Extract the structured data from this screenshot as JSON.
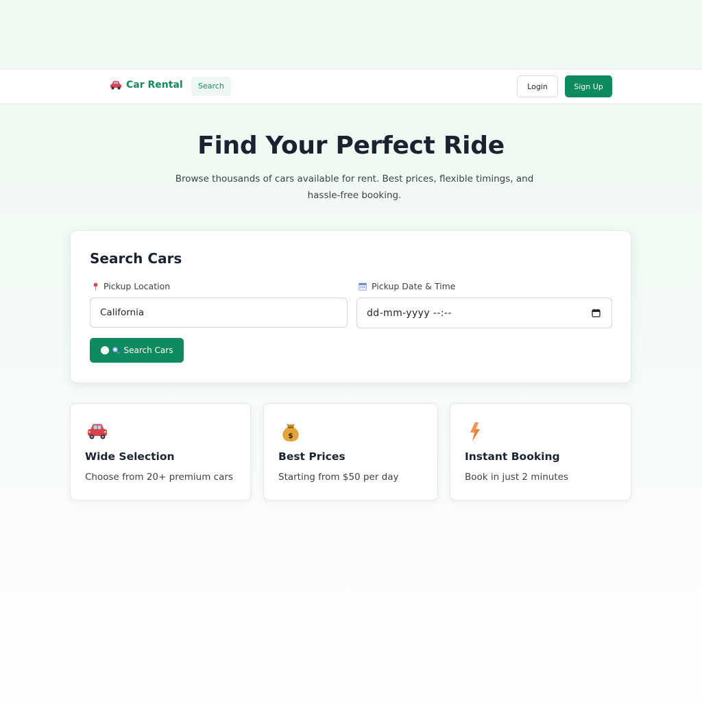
{
  "header": {
    "brand_icon": "car-icon",
    "brand_name": "Car Rental",
    "nav_search_label": "Search",
    "login_label": "Login",
    "signup_label": "Sign Up"
  },
  "hero": {
    "title": "Find Your Perfect Ride",
    "subtitle": "Browse thousands of cars available for rent. Best prices, flexible timings, and hassle-free booking."
  },
  "search": {
    "title": "Search Cars",
    "location_label": "Pickup Location",
    "location_icon": "pin-icon",
    "location_value": "California",
    "date_label": "Pickup Date & Time",
    "date_icon": "calendar-icon",
    "date_placeholder": "dd-mm-yyyy --:--",
    "button_label": "Search Cars",
    "button_icon": "magnifier-icon"
  },
  "features": [
    {
      "icon": "car-icon",
      "title": "Wide Selection",
      "desc": "Choose from 20+ premium cars"
    },
    {
      "icon": "money-bag-icon",
      "title": "Best Prices",
      "desc": "Starting from $50 per day"
    },
    {
      "icon": "lightning-icon",
      "title": "Instant Booking",
      "desc": "Book in just 2 minutes"
    }
  ],
  "colors": {
    "accent": "#0e8a5f",
    "brand_text": "#128a5c",
    "background": "#eff8f1"
  }
}
